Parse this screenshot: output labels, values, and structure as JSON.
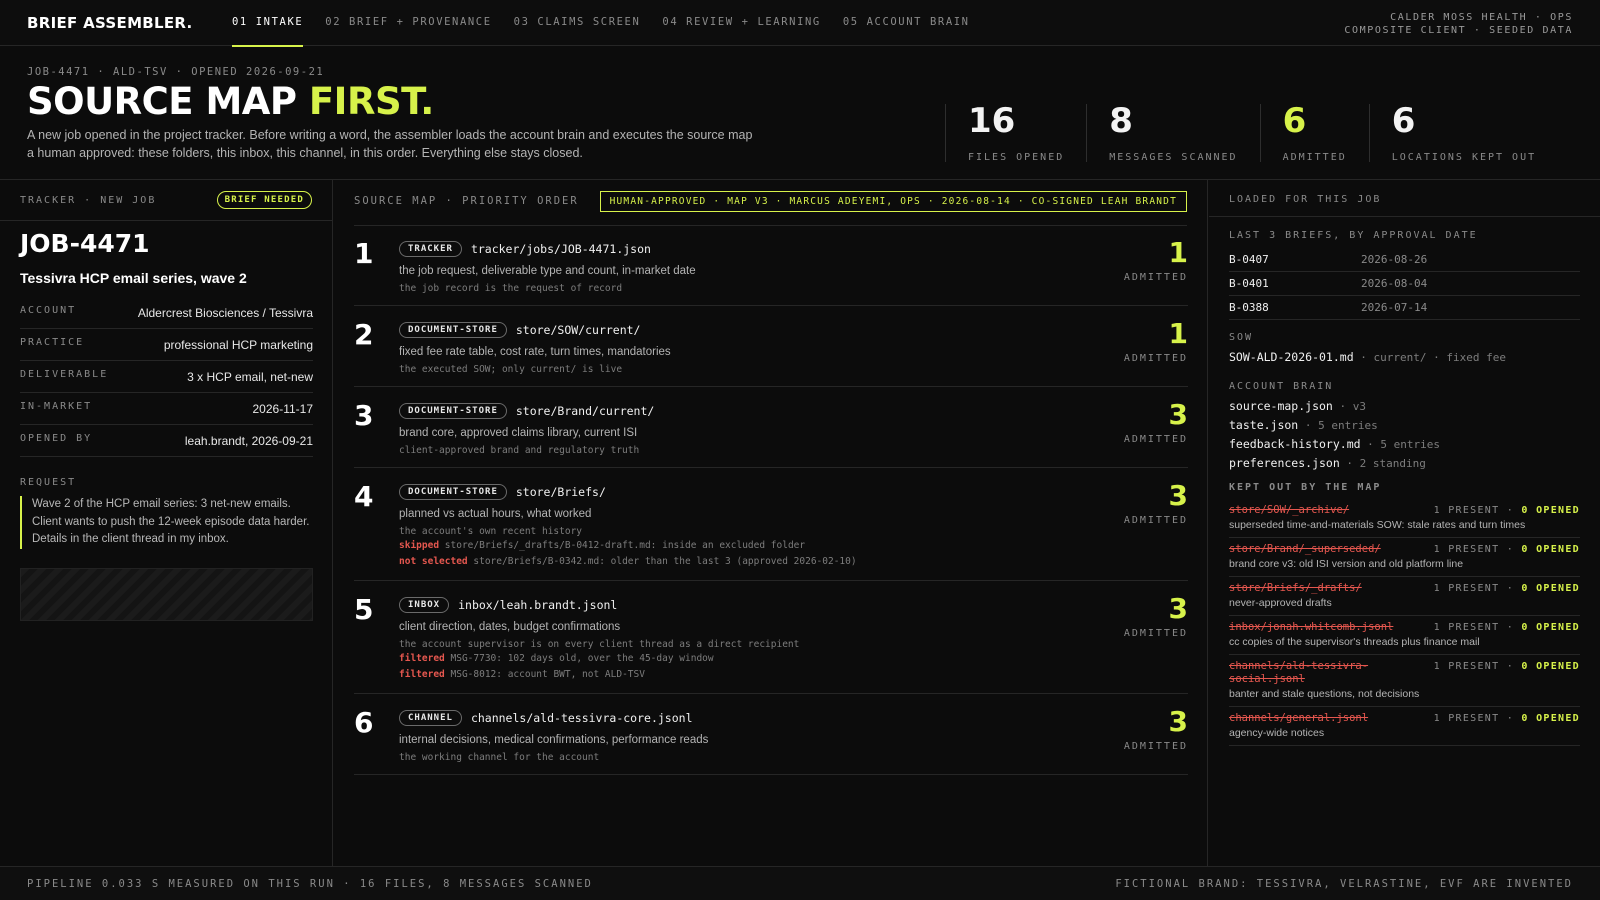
{
  "nav": {
    "brand": "BRIEF ASSEMBLER.",
    "tabs": [
      {
        "label": "01 INTAKE",
        "active": true
      },
      {
        "label": "02 BRIEF + PROVENANCE",
        "active": false
      },
      {
        "label": "03 CLAIMS SCREEN",
        "active": false
      },
      {
        "label": "04 REVIEW + LEARNING",
        "active": false
      },
      {
        "label": "05 ACCOUNT BRAIN",
        "active": false
      }
    ],
    "client_line1": "CALDER MOSS HEALTH · OPS",
    "client_line2": "COMPOSITE CLIENT · SEEDED DATA"
  },
  "hero": {
    "meta": "JOB-4471 · ALD-TSV · OPENED 2026-09-21",
    "title_main": "SOURCE MAP ",
    "title_accent": "FIRST.",
    "intro": "A new job opened in the project tracker. Before writing a word, the assembler loads the account brain and executes the source map a human approved: these folders, this inbox, this channel, in this order. Everything else stays closed.",
    "stats": [
      {
        "value": "16",
        "label": "FILES OPENED",
        "accent": false
      },
      {
        "value": "8",
        "label": "MESSAGES SCANNED",
        "accent": false
      },
      {
        "value": "6",
        "label": "ADMITTED",
        "accent": true
      },
      {
        "value": "6",
        "label": "LOCATIONS KEPT OUT",
        "accent": false
      }
    ]
  },
  "tracker": {
    "header": "TRACKER · NEW JOB",
    "badge": "BRIEF NEEDED",
    "job_id": "JOB-4471",
    "job_name": "Tessivra HCP email series, wave 2",
    "fields": [
      {
        "key": "ACCOUNT",
        "value": "Aldercrest Biosciences / Tessivra"
      },
      {
        "key": "PRACTICE",
        "value": "professional HCP marketing"
      },
      {
        "key": "DELIVERABLE",
        "value": "3 x HCP email, net-new"
      },
      {
        "key": "IN-MARKET",
        "value": "2026-11-17"
      },
      {
        "key": "OPENED BY",
        "value": "leah.brandt, 2026-09-21"
      }
    ],
    "request_label": "REQUEST",
    "request_text": "Wave 2 of the HCP email series: 3 net-new emails. Client wants to push the 12-week episode data harder. Details in the client thread in my inbox."
  },
  "source_map": {
    "header": "SOURCE MAP · PRIORITY ORDER",
    "approval": "HUMAN-APPROVED · MAP V3 · MARCUS ADEYEMI, OPS · 2026-08-14 · CO-SIGNED LEAH BRANDT",
    "admitted_label": "ADMITTED",
    "sources": [
      {
        "n": "1",
        "type": "TRACKER",
        "path": "tracker/jobs/JOB-4471.json",
        "desc": "the job request, deliverable type and count, in-market date",
        "note": "the job record is the request of record",
        "count": "1",
        "extras": []
      },
      {
        "n": "2",
        "type": "DOCUMENT-STORE",
        "path": "store/SOW/current/",
        "desc": "fixed fee rate table, cost rate, turn times, mandatories",
        "note": "the executed SOW; only current/ is live",
        "count": "1",
        "extras": []
      },
      {
        "n": "3",
        "type": "DOCUMENT-STORE",
        "path": "store/Brand/current/",
        "desc": "brand core, approved claims library, current ISI",
        "note": "client-approved brand and regulatory truth",
        "count": "3",
        "extras": []
      },
      {
        "n": "4",
        "type": "DOCUMENT-STORE",
        "path": "store/Briefs/",
        "desc": "planned vs actual hours, what worked",
        "note": "the account's own recent history",
        "count": "3",
        "extras": [
          {
            "tag": "skipped",
            "text": "store/Briefs/_drafts/B-0412-draft.md: inside an excluded folder"
          },
          {
            "tag": "not selected",
            "text": "store/Briefs/B-0342.md: older than the last 3 (approved 2026-02-10)"
          }
        ]
      },
      {
        "n": "5",
        "type": "INBOX",
        "path": "inbox/leah.brandt.jsonl",
        "desc": "client direction, dates, budget confirmations",
        "note": "the account supervisor is on every client thread as a direct recipient",
        "count": "3",
        "extras": [
          {
            "tag": "filtered",
            "text": "MSG-7730: 102 days old, over the 45-day window"
          },
          {
            "tag": "filtered",
            "text": "MSG-8012: account BWT, not ALD-TSV"
          }
        ]
      },
      {
        "n": "6",
        "type": "CHANNEL",
        "path": "channels/ald-tessivra-core.jsonl",
        "desc": "internal decisions, medical confirmations, performance reads",
        "note": "the working channel for the account",
        "count": "3",
        "extras": []
      }
    ]
  },
  "loaded": {
    "header": "LOADED FOR THIS JOB",
    "briefs_label": "LAST 3 BRIEFS, BY APPROVAL DATE",
    "briefs": [
      {
        "id": "B-0407",
        "date": "2026-08-26"
      },
      {
        "id": "B-0401",
        "date": "2026-08-04"
      },
      {
        "id": "B-0388",
        "date": "2026-07-14"
      }
    ],
    "sow_label": "SOW",
    "sow_file": "SOW-ALD-2026-01.md",
    "sow_note": " · current/ · fixed fee",
    "brain_label": "ACCOUNT BRAIN",
    "brain": [
      {
        "file": "source-map.json",
        "note": " · v3"
      },
      {
        "file": "taste.json",
        "note": " · 5 entries"
      },
      {
        "file": "feedback-history.md",
        "note": " · 5 entries"
      },
      {
        "file": "preferences.json",
        "note": " · 2 standing"
      }
    ],
    "kept_label": "KEPT OUT BY THE MAP",
    "kept": [
      {
        "path": "store/SOW/_archive/",
        "present": "1 PRESENT · ",
        "opened": "0 OPENED",
        "desc": "superseded time-and-materials SOW: stale rates and turn times"
      },
      {
        "path": "store/Brand/_superseded/",
        "present": "1 PRESENT · ",
        "opened": "0 OPENED",
        "desc": "brand core v3: old ISI version and old platform line"
      },
      {
        "path": "store/Briefs/_drafts/",
        "present": "1 PRESENT · ",
        "opened": "0 OPENED",
        "desc": "never-approved drafts"
      },
      {
        "path": "inbox/jonah.whitcomb.jsonl",
        "present": "1 PRESENT · ",
        "opened": "0 OPENED",
        "desc": "cc copies of the supervisor's threads plus finance mail"
      },
      {
        "path": "channels/ald-tessivra-social.jsonl",
        "present": "1 PRESENT · ",
        "opened": "0 OPENED",
        "desc": "banter and stale questions, not decisions"
      },
      {
        "path": "channels/general.jsonl",
        "present": "1 PRESENT · ",
        "opened": "0 OPENED",
        "desc": "agency-wide notices"
      }
    ]
  },
  "footer": {
    "left": "PIPELINE 0.033 S MEASURED ON THIS RUN · 16 FILES, 8 MESSAGES SCANNED",
    "right": "FICTIONAL BRAND: TESSIVRA, VELRASTINE, EVF ARE INVENTED"
  },
  "colors": {
    "accent": "#d7f24a",
    "alert": "#e5574f",
    "background": "#0c0c0c"
  }
}
